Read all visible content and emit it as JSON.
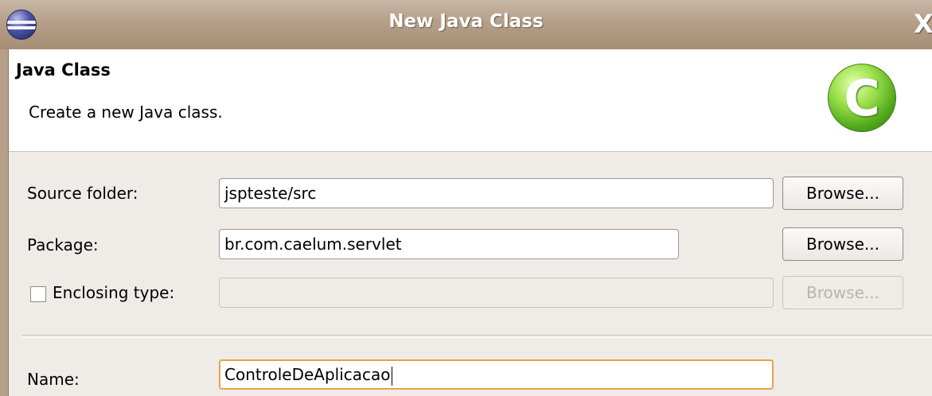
{
  "window": {
    "title": "New Java Class",
    "close_label": "X"
  },
  "header": {
    "title": "Java Class",
    "description": "Create a new Java class.",
    "icon_letter": "C"
  },
  "form": {
    "source_folder": {
      "label": "Source folder:",
      "value": "jspteste/src",
      "browse": "Browse..."
    },
    "package": {
      "label": "Package:",
      "value": "br.com.caelum.servlet",
      "browse": "Browse..."
    },
    "enclosing_type": {
      "label": "Enclosing type:",
      "value": "",
      "browse": "Browse...",
      "checked": false
    },
    "name": {
      "label": "Name:",
      "value": "ControleDeAplicacao"
    }
  }
}
